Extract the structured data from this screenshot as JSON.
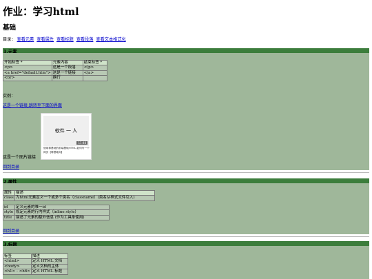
{
  "page_title": "作业：学习html",
  "sub_title": "基础",
  "toc": {
    "label": "目录：",
    "links": [
      "查看元素",
      "查看属性",
      "查看标题",
      "查看段落",
      "查看文本格式化"
    ]
  },
  "section1": {
    "title": "1.元素",
    "table": {
      "headers": [
        "开始标签 *",
        "元素内容",
        "结束标签 *"
      ],
      "rows": [
        [
          "<p>",
          "这是一个段落",
          "</p>"
        ],
        [
          "<a href=\"default.htm\">",
          "这是一个链接",
          "</a>"
        ],
        [
          "<br>",
          "换行",
          ""
        ]
      ]
    },
    "example_label": "实例：",
    "example_link": "这是一个链接,跳转至下面的界面",
    "image_caption": "这是一个图片链接",
    "image_card": {
      "label": "软件 一 人",
      "duration": "11:48",
      "caption": "使用零基础的前端基础HTML-如何写一个网页【零基础向】"
    },
    "back_link": "回到目录"
  },
  "section2": {
    "title": "2.属性",
    "table_main": {
      "headers": [
        "属性",
        "描述"
      ],
      "rows": [
        [
          "class",
          "为html元素定义一个或多个类名（classname）(类名从样式文件引入)"
        ]
      ]
    },
    "table_more": {
      "rows": [
        [
          "id",
          "定义元素的唯一id"
        ],
        [
          "style",
          "规定元素的行内样式（inline style）"
        ],
        [
          "title",
          "描述了元素的额外信息 (作为工具条使用)"
        ]
      ]
    },
    "back_link": "回到目录"
  },
  "section3": {
    "title": "3.标题",
    "table": {
      "headers": [
        "标签",
        "描述"
      ],
      "rows": [
        [
          "<html>",
          "定义 HTML 文档"
        ],
        [
          "<body>",
          "定义文档的主体"
        ],
        [
          "<h1> - <h6>",
          "定义 HTML 标题"
        ]
      ]
    }
  }
}
